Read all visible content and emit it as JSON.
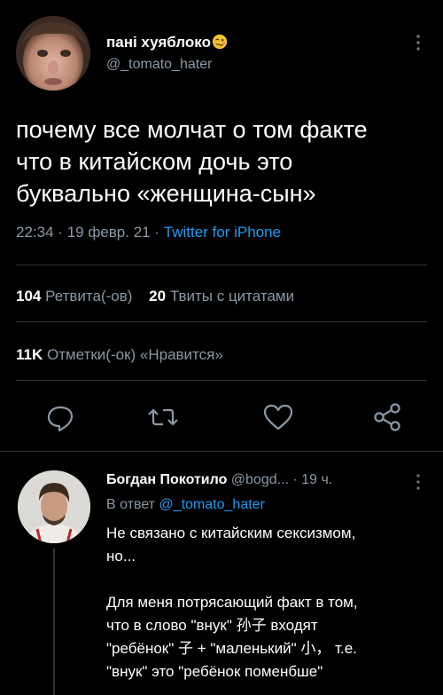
{
  "tweet": {
    "author_name": "пані хуяблоко",
    "author_handle": "@_tomato_hater",
    "text": "почему все молчат о том факте\nчто в китайском дочь это\nбуквально «женщина-сын»",
    "time": "22:34",
    "date": "19 февр. 21",
    "source": "Twitter for iPhone",
    "stats": {
      "retweets_count": "104",
      "retweets_label": "Ретвита(-ов)",
      "quotes_count": "20",
      "quotes_label": "Твиты с цитатами",
      "likes_count": "11K",
      "likes_label": "Отметки(-ок) «Нравится»"
    },
    "icons": {
      "author_emoji": "woozy-face-emoji",
      "more": "more-vertical-icon",
      "reply": "reply-icon",
      "retweet": "retweet-icon",
      "like": "heart-icon",
      "share": "share-icon"
    }
  },
  "reply": {
    "author_name": "Богдан Покотило",
    "author_handle": "@bogd...",
    "time_ago": "19 ч.",
    "replying_to_label": "В ответ",
    "replying_to_handle": "@_tomato_hater",
    "text": "Не связано с китайским сексизмом,\nно...\n\nДля меня потрясающий факт в том,\nчто в слово \"внук\" 孙子 входят\n\"ребёнок\" 子 + \"маленький\" 小，  т.е.\n\"внук\" это \"ребёнок поменбше\""
  },
  "colors": {
    "background": "#000000",
    "primary_text": "#ffffff",
    "secondary_text": "#8b98a5",
    "accent": "#1d9bf0",
    "divider": "#2f3336"
  }
}
